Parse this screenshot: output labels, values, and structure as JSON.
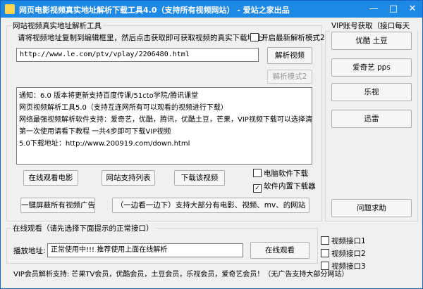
{
  "window": {
    "title": "网页电影视频真实地址解析下载工具4.0（支持所有视频网站） - 爱站之家出品",
    "min_glyph": "—",
    "max_glyph": "□",
    "close_glyph": "✕"
  },
  "parse_group": {
    "legend": "网站视频真实地址解析工具",
    "instruction": "请将视频地址复制到编辑框里，然后点击获取即可获取视频的真实下载地址！",
    "new_mode_label": "开启最新解析模式2",
    "new_mode_checked": false,
    "url_value": "http://www.le.com/ptv/vplay/2206480.html",
    "parse_button": "解析视频",
    "mode2_button": "解析模式2"
  },
  "notice_lines": [
    "通知：6.0 版本将更新支持百度传课/51cto学院/腾讯课堂",
    "网页视频解析工具5.0（支持互连网所有可以观看的视频进行下载）",
    "网络最强视频解析软件支持：爱奇艺，优酷，腾讯，优酷土豆，芒果，VIP视频下载可以选择清晰度",
    "第一次使用请看下教程 一共4步即可下载VIP视频",
    "5.0下载地址：http://www.200919.com/down.html"
  ],
  "actions": {
    "watch_online": "在线观看电影",
    "site_list": "网站支持列表",
    "download_video": "下载该视频",
    "block_ads": "一键屏蔽所有视频广告",
    "watch_while_download": "（一边看一边下）支持大部分有电影、视频、mv、的网站"
  },
  "download_options": {
    "pc_software": {
      "label": "电脑软件下载",
      "checked": false
    },
    "builtin": {
      "label": "软件内置下载器",
      "checked": true
    }
  },
  "vip_group": {
    "legend": "VIP账号获取（接口每天更新）",
    "buttons": [
      "优酷 土豆",
      "爱奇艺 pps",
      "乐视",
      "迅雷"
    ],
    "help_button": "问题求助"
  },
  "online_group": {
    "legend": "在线观看（请先选择下面提示的正常接口）",
    "play_label": "播放地址:",
    "play_value": "正常使用中!!! 推荐使用上面在线解析",
    "watch_button": "在线观看",
    "interfaces": [
      {
        "label": "视频接口1",
        "checked": false
      },
      {
        "label": "视频接口2",
        "checked": false
      },
      {
        "label": "视频接口3",
        "checked": false
      }
    ]
  },
  "footer": "VIP会员解析支持: 芒果TV会员，优酷会员，土豆会员，乐视会员，爱奇艺会员！（无广告支持大部分网站）"
}
